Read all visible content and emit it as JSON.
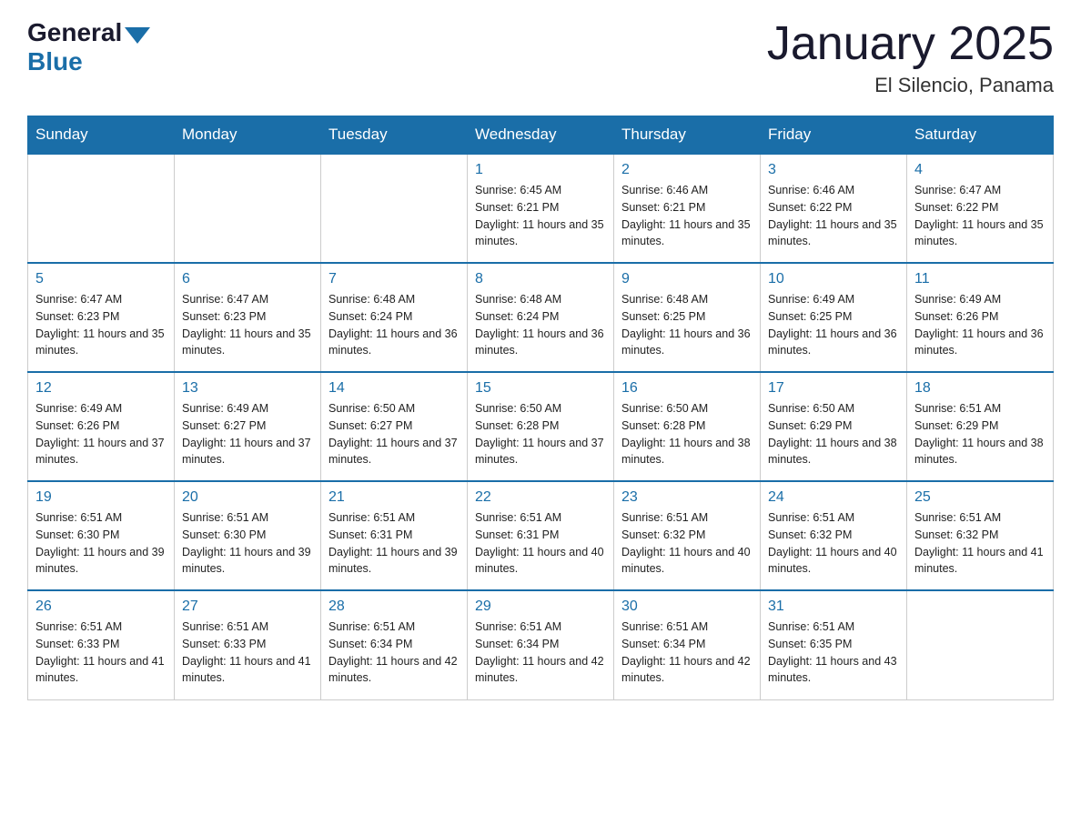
{
  "header": {
    "logo_general": "General",
    "logo_blue": "Blue",
    "month_title": "January 2025",
    "location": "El Silencio, Panama"
  },
  "days_of_week": [
    "Sunday",
    "Monday",
    "Tuesday",
    "Wednesday",
    "Thursday",
    "Friday",
    "Saturday"
  ],
  "weeks": [
    [
      {
        "day": "",
        "sunrise": "",
        "sunset": "",
        "daylight": ""
      },
      {
        "day": "",
        "sunrise": "",
        "sunset": "",
        "daylight": ""
      },
      {
        "day": "",
        "sunrise": "",
        "sunset": "",
        "daylight": ""
      },
      {
        "day": "1",
        "sunrise": "Sunrise: 6:45 AM",
        "sunset": "Sunset: 6:21 PM",
        "daylight": "Daylight: 11 hours and 35 minutes."
      },
      {
        "day": "2",
        "sunrise": "Sunrise: 6:46 AM",
        "sunset": "Sunset: 6:21 PM",
        "daylight": "Daylight: 11 hours and 35 minutes."
      },
      {
        "day": "3",
        "sunrise": "Sunrise: 6:46 AM",
        "sunset": "Sunset: 6:22 PM",
        "daylight": "Daylight: 11 hours and 35 minutes."
      },
      {
        "day": "4",
        "sunrise": "Sunrise: 6:47 AM",
        "sunset": "Sunset: 6:22 PM",
        "daylight": "Daylight: 11 hours and 35 minutes."
      }
    ],
    [
      {
        "day": "5",
        "sunrise": "Sunrise: 6:47 AM",
        "sunset": "Sunset: 6:23 PM",
        "daylight": "Daylight: 11 hours and 35 minutes."
      },
      {
        "day": "6",
        "sunrise": "Sunrise: 6:47 AM",
        "sunset": "Sunset: 6:23 PM",
        "daylight": "Daylight: 11 hours and 35 minutes."
      },
      {
        "day": "7",
        "sunrise": "Sunrise: 6:48 AM",
        "sunset": "Sunset: 6:24 PM",
        "daylight": "Daylight: 11 hours and 36 minutes."
      },
      {
        "day": "8",
        "sunrise": "Sunrise: 6:48 AM",
        "sunset": "Sunset: 6:24 PM",
        "daylight": "Daylight: 11 hours and 36 minutes."
      },
      {
        "day": "9",
        "sunrise": "Sunrise: 6:48 AM",
        "sunset": "Sunset: 6:25 PM",
        "daylight": "Daylight: 11 hours and 36 minutes."
      },
      {
        "day": "10",
        "sunrise": "Sunrise: 6:49 AM",
        "sunset": "Sunset: 6:25 PM",
        "daylight": "Daylight: 11 hours and 36 minutes."
      },
      {
        "day": "11",
        "sunrise": "Sunrise: 6:49 AM",
        "sunset": "Sunset: 6:26 PM",
        "daylight": "Daylight: 11 hours and 36 minutes."
      }
    ],
    [
      {
        "day": "12",
        "sunrise": "Sunrise: 6:49 AM",
        "sunset": "Sunset: 6:26 PM",
        "daylight": "Daylight: 11 hours and 37 minutes."
      },
      {
        "day": "13",
        "sunrise": "Sunrise: 6:49 AM",
        "sunset": "Sunset: 6:27 PM",
        "daylight": "Daylight: 11 hours and 37 minutes."
      },
      {
        "day": "14",
        "sunrise": "Sunrise: 6:50 AM",
        "sunset": "Sunset: 6:27 PM",
        "daylight": "Daylight: 11 hours and 37 minutes."
      },
      {
        "day": "15",
        "sunrise": "Sunrise: 6:50 AM",
        "sunset": "Sunset: 6:28 PM",
        "daylight": "Daylight: 11 hours and 37 minutes."
      },
      {
        "day": "16",
        "sunrise": "Sunrise: 6:50 AM",
        "sunset": "Sunset: 6:28 PM",
        "daylight": "Daylight: 11 hours and 38 minutes."
      },
      {
        "day": "17",
        "sunrise": "Sunrise: 6:50 AM",
        "sunset": "Sunset: 6:29 PM",
        "daylight": "Daylight: 11 hours and 38 minutes."
      },
      {
        "day": "18",
        "sunrise": "Sunrise: 6:51 AM",
        "sunset": "Sunset: 6:29 PM",
        "daylight": "Daylight: 11 hours and 38 minutes."
      }
    ],
    [
      {
        "day": "19",
        "sunrise": "Sunrise: 6:51 AM",
        "sunset": "Sunset: 6:30 PM",
        "daylight": "Daylight: 11 hours and 39 minutes."
      },
      {
        "day": "20",
        "sunrise": "Sunrise: 6:51 AM",
        "sunset": "Sunset: 6:30 PM",
        "daylight": "Daylight: 11 hours and 39 minutes."
      },
      {
        "day": "21",
        "sunrise": "Sunrise: 6:51 AM",
        "sunset": "Sunset: 6:31 PM",
        "daylight": "Daylight: 11 hours and 39 minutes."
      },
      {
        "day": "22",
        "sunrise": "Sunrise: 6:51 AM",
        "sunset": "Sunset: 6:31 PM",
        "daylight": "Daylight: 11 hours and 40 minutes."
      },
      {
        "day": "23",
        "sunrise": "Sunrise: 6:51 AM",
        "sunset": "Sunset: 6:32 PM",
        "daylight": "Daylight: 11 hours and 40 minutes."
      },
      {
        "day": "24",
        "sunrise": "Sunrise: 6:51 AM",
        "sunset": "Sunset: 6:32 PM",
        "daylight": "Daylight: 11 hours and 40 minutes."
      },
      {
        "day": "25",
        "sunrise": "Sunrise: 6:51 AM",
        "sunset": "Sunset: 6:32 PM",
        "daylight": "Daylight: 11 hours and 41 minutes."
      }
    ],
    [
      {
        "day": "26",
        "sunrise": "Sunrise: 6:51 AM",
        "sunset": "Sunset: 6:33 PM",
        "daylight": "Daylight: 11 hours and 41 minutes."
      },
      {
        "day": "27",
        "sunrise": "Sunrise: 6:51 AM",
        "sunset": "Sunset: 6:33 PM",
        "daylight": "Daylight: 11 hours and 41 minutes."
      },
      {
        "day": "28",
        "sunrise": "Sunrise: 6:51 AM",
        "sunset": "Sunset: 6:34 PM",
        "daylight": "Daylight: 11 hours and 42 minutes."
      },
      {
        "day": "29",
        "sunrise": "Sunrise: 6:51 AM",
        "sunset": "Sunset: 6:34 PM",
        "daylight": "Daylight: 11 hours and 42 minutes."
      },
      {
        "day": "30",
        "sunrise": "Sunrise: 6:51 AM",
        "sunset": "Sunset: 6:34 PM",
        "daylight": "Daylight: 11 hours and 42 minutes."
      },
      {
        "day": "31",
        "sunrise": "Sunrise: 6:51 AM",
        "sunset": "Sunset: 6:35 PM",
        "daylight": "Daylight: 11 hours and 43 minutes."
      },
      {
        "day": "",
        "sunrise": "",
        "sunset": "",
        "daylight": ""
      }
    ]
  ]
}
